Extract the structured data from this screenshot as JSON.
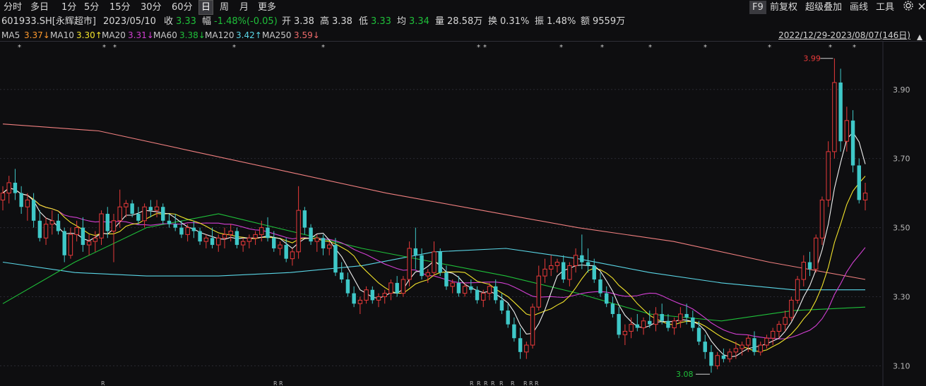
{
  "toolbar": {
    "periods": [
      "分时",
      "多日",
      "1分",
      "5分",
      "15分",
      "30分",
      "60分",
      "日",
      "周",
      "月",
      "更多"
    ],
    "active_period": "日",
    "right": {
      "f9": "F9",
      "fq": "前复权",
      "overlay": "超级叠加",
      "draw": "画线",
      "tools": "工具"
    },
    "settings_icon": "gear-icon",
    "close_icon": "close-icon"
  },
  "quote": {
    "code": "601933.SH[永辉超市]",
    "date": "2023/05/10",
    "close_label": "收",
    "close": "3.33",
    "change_label": "幅",
    "change": "-1.48%(-0.05)",
    "open_label": "开",
    "open": "3.38",
    "high_label": "高",
    "high": "3.38",
    "low_label": "低",
    "low": "3.33",
    "avg_label": "均",
    "avg": "3.34",
    "vol_label": "量",
    "vol": "28.58万",
    "turnover_label": "换",
    "turnover": "0.31%",
    "amp_label": "振",
    "amp": "1.48%",
    "amount_label": "额",
    "amount": "9559万"
  },
  "ma": [
    {
      "name": "MA5",
      "value": "3.37↓",
      "color": "#e6e6e6",
      "value_color": "#ff9a2e"
    },
    {
      "name": "MA10",
      "value": "3.30↑",
      "color": "#e6e6e6",
      "value_color": "#f2e32b"
    },
    {
      "name": "MA20",
      "value": "3.31↓",
      "color": "#e6e6e6",
      "value_color": "#d23fd2"
    },
    {
      "name": "MA60",
      "value": "3.38↓",
      "color": "#e6e6e6",
      "value_color": "#1fc03a"
    },
    {
      "name": "MA120",
      "value": "3.42↑",
      "color": "#e6e6e6",
      "value_color": "#5ad6e6"
    },
    {
      "name": "MA250",
      "value": "3.59↓",
      "color": "#e6e6e6",
      "value_color": "#ef6b6b"
    }
  ],
  "range_text": "2022/12/29-2023/08/07(146日)",
  "chart_data": {
    "type": "candlestick",
    "y_ticks": [
      "3.90",
      "3.70",
      "3.50",
      "3.30",
      "3.10"
    ],
    "ylim": [
      3.06,
      4.02
    ],
    "max_label": "3.99",
    "min_label": "3.08",
    "markers_top": "*",
    "markers_bottom": "R",
    "colors": {
      "up": "#e83a3a",
      "down": "#3fc8c8",
      "ma5": "#f2f2f2",
      "ma10": "#f2e32b",
      "ma20": "#d23fd2",
      "ma60": "#1fc03a",
      "ma120": "#5ad6e6",
      "ma250": "#ef7f7f",
      "grid": "#2a2a33"
    },
    "candles_ohlc": [
      [
        3.58,
        3.62,
        3.55,
        3.6
      ],
      [
        3.6,
        3.65,
        3.57,
        3.63
      ],
      [
        3.63,
        3.67,
        3.58,
        3.6
      ],
      [
        3.6,
        3.62,
        3.54,
        3.56
      ],
      [
        3.56,
        3.6,
        3.52,
        3.58
      ],
      [
        3.58,
        3.6,
        3.5,
        3.52
      ],
      [
        3.52,
        3.55,
        3.46,
        3.47
      ],
      [
        3.47,
        3.53,
        3.45,
        3.51
      ],
      [
        3.51,
        3.55,
        3.48,
        3.52
      ],
      [
        3.52,
        3.54,
        3.48,
        3.49
      ],
      [
        3.49,
        3.5,
        3.4,
        3.42
      ],
      [
        3.42,
        3.5,
        3.41,
        3.48
      ],
      [
        3.48,
        3.52,
        3.46,
        3.5
      ],
      [
        3.5,
        3.53,
        3.43,
        3.45
      ],
      [
        3.45,
        3.48,
        3.42,
        3.46
      ],
      [
        3.46,
        3.49,
        3.43,
        3.47
      ],
      [
        3.47,
        3.55,
        3.45,
        3.54
      ],
      [
        3.54,
        3.56,
        3.47,
        3.49
      ],
      [
        3.49,
        3.54,
        3.4,
        3.52
      ],
      [
        3.52,
        3.61,
        3.5,
        3.56
      ],
      [
        3.56,
        3.58,
        3.53,
        3.57
      ],
      [
        3.57,
        3.58,
        3.53,
        3.54
      ],
      [
        3.54,
        3.56,
        3.51,
        3.52
      ],
      [
        3.52,
        3.57,
        3.5,
        3.56
      ],
      [
        3.56,
        3.58,
        3.53,
        3.55
      ],
      [
        3.55,
        3.58,
        3.53,
        3.56
      ],
      [
        3.56,
        3.57,
        3.51,
        3.52
      ],
      [
        3.52,
        3.54,
        3.5,
        3.51
      ],
      [
        3.51,
        3.54,
        3.49,
        3.5
      ],
      [
        3.5,
        3.52,
        3.47,
        3.48
      ],
      [
        3.48,
        3.51,
        3.46,
        3.5
      ],
      [
        3.5,
        3.52,
        3.47,
        3.49
      ],
      [
        3.49,
        3.5,
        3.45,
        3.46
      ],
      [
        3.46,
        3.48,
        3.44,
        3.47
      ],
      [
        3.47,
        3.5,
        3.44,
        3.45
      ],
      [
        3.45,
        3.48,
        3.43,
        3.47
      ],
      [
        3.47,
        3.5,
        3.44,
        3.48
      ],
      [
        3.48,
        3.51,
        3.46,
        3.49
      ],
      [
        3.49,
        3.5,
        3.44,
        3.45
      ],
      [
        3.45,
        3.47,
        3.43,
        3.46
      ],
      [
        3.46,
        3.48,
        3.44,
        3.47
      ],
      [
        3.47,
        3.49,
        3.45,
        3.48
      ],
      [
        3.48,
        3.52,
        3.46,
        3.5
      ],
      [
        3.5,
        3.53,
        3.46,
        3.47
      ],
      [
        3.47,
        3.49,
        3.43,
        3.44
      ],
      [
        3.44,
        3.46,
        3.42,
        3.45
      ],
      [
        3.45,
        3.47,
        3.4,
        3.41
      ],
      [
        3.41,
        3.44,
        3.39,
        3.43
      ],
      [
        3.43,
        3.62,
        3.41,
        3.55
      ],
      [
        3.55,
        3.56,
        3.48,
        3.5
      ],
      [
        3.5,
        3.51,
        3.45,
        3.46
      ],
      [
        3.46,
        3.48,
        3.43,
        3.47
      ],
      [
        3.47,
        3.48,
        3.42,
        3.44
      ],
      [
        3.44,
        3.46,
        3.42,
        3.45
      ],
      [
        3.45,
        3.47,
        3.36,
        3.37
      ],
      [
        3.37,
        3.4,
        3.34,
        3.35
      ],
      [
        3.35,
        3.37,
        3.3,
        3.31
      ],
      [
        3.31,
        3.33,
        3.27,
        3.28
      ],
      [
        3.28,
        3.3,
        3.25,
        3.29
      ],
      [
        3.29,
        3.33,
        3.28,
        3.32
      ],
      [
        3.32,
        3.33,
        3.28,
        3.29
      ],
      [
        3.29,
        3.31,
        3.27,
        3.3
      ],
      [
        3.3,
        3.32,
        3.28,
        3.31
      ],
      [
        3.31,
        3.35,
        3.29,
        3.34
      ],
      [
        3.34,
        3.36,
        3.3,
        3.31
      ],
      [
        3.31,
        3.36,
        3.3,
        3.35
      ],
      [
        3.35,
        3.46,
        3.33,
        3.44
      ],
      [
        3.44,
        3.5,
        3.38,
        3.42
      ],
      [
        3.42,
        3.44,
        3.35,
        3.36
      ],
      [
        3.36,
        3.38,
        3.34,
        3.37
      ],
      [
        3.37,
        3.46,
        3.36,
        3.43
      ],
      [
        3.43,
        3.44,
        3.36,
        3.37
      ],
      [
        3.37,
        3.39,
        3.32,
        3.33
      ],
      [
        3.33,
        3.35,
        3.31,
        3.34
      ],
      [
        3.34,
        3.36,
        3.3,
        3.31
      ],
      [
        3.31,
        3.34,
        3.3,
        3.33
      ],
      [
        3.33,
        3.35,
        3.31,
        3.32
      ],
      [
        3.32,
        3.33,
        3.28,
        3.29
      ],
      [
        3.29,
        3.32,
        3.27,
        3.31
      ],
      [
        3.31,
        3.34,
        3.29,
        3.33
      ],
      [
        3.33,
        3.35,
        3.28,
        3.29
      ],
      [
        3.29,
        3.31,
        3.25,
        3.26
      ],
      [
        3.26,
        3.28,
        3.21,
        3.22
      ],
      [
        3.22,
        3.24,
        3.17,
        3.18
      ],
      [
        3.18,
        3.21,
        3.12,
        3.14
      ],
      [
        3.14,
        3.17,
        3.12,
        3.16
      ],
      [
        3.16,
        3.28,
        3.15,
        3.27
      ],
      [
        3.27,
        3.39,
        3.26,
        3.36
      ],
      [
        3.36,
        3.41,
        3.34,
        3.38
      ],
      [
        3.38,
        3.42,
        3.36,
        3.39
      ],
      [
        3.39,
        3.41,
        3.37,
        3.4
      ],
      [
        3.4,
        3.42,
        3.34,
        3.35
      ],
      [
        3.35,
        3.4,
        3.33,
        3.39
      ],
      [
        3.39,
        3.44,
        3.37,
        3.42
      ],
      [
        3.42,
        3.48,
        3.38,
        3.4
      ],
      [
        3.4,
        3.44,
        3.37,
        3.39
      ],
      [
        3.39,
        3.41,
        3.34,
        3.35
      ],
      [
        3.35,
        3.37,
        3.3,
        3.31
      ],
      [
        3.31,
        3.33,
        3.27,
        3.28
      ],
      [
        3.28,
        3.3,
        3.24,
        3.25
      ],
      [
        3.25,
        3.27,
        3.18,
        3.19
      ],
      [
        3.19,
        3.22,
        3.16,
        3.2
      ],
      [
        3.2,
        3.24,
        3.18,
        3.22
      ],
      [
        3.22,
        3.25,
        3.2,
        3.21
      ],
      [
        3.21,
        3.24,
        3.19,
        3.23
      ],
      [
        3.23,
        3.26,
        3.21,
        3.22
      ],
      [
        3.22,
        3.27,
        3.2,
        3.25
      ],
      [
        3.25,
        3.28,
        3.22,
        3.23
      ],
      [
        3.23,
        3.25,
        3.2,
        3.21
      ],
      [
        3.21,
        3.24,
        3.19,
        3.23
      ],
      [
        3.23,
        3.27,
        3.21,
        3.25
      ],
      [
        3.25,
        3.28,
        3.22,
        3.24
      ],
      [
        3.24,
        3.26,
        3.2,
        3.21
      ],
      [
        3.21,
        3.23,
        3.16,
        3.17
      ],
      [
        3.17,
        3.19,
        3.12,
        3.14
      ],
      [
        3.14,
        3.16,
        3.08,
        3.1
      ],
      [
        3.1,
        3.14,
        3.09,
        3.13
      ],
      [
        3.13,
        3.15,
        3.11,
        3.12
      ],
      [
        3.12,
        3.15,
        3.11,
        3.14
      ],
      [
        3.14,
        3.17,
        3.12,
        3.15
      ],
      [
        3.15,
        3.17,
        3.13,
        3.16
      ],
      [
        3.16,
        3.19,
        3.14,
        3.18
      ],
      [
        3.18,
        3.2,
        3.13,
        3.14
      ],
      [
        3.14,
        3.17,
        3.13,
        3.16
      ],
      [
        3.16,
        3.19,
        3.15,
        3.18
      ],
      [
        3.18,
        3.21,
        3.16,
        3.2
      ],
      [
        3.2,
        3.23,
        3.18,
        3.22
      ],
      [
        3.22,
        3.26,
        3.2,
        3.24
      ],
      [
        3.24,
        3.3,
        3.23,
        3.29
      ],
      [
        3.29,
        3.36,
        3.28,
        3.35
      ],
      [
        3.35,
        3.42,
        3.33,
        3.4
      ],
      [
        3.4,
        3.43,
        3.36,
        3.38
      ],
      [
        3.38,
        3.48,
        3.37,
        3.47
      ],
      [
        3.47,
        3.59,
        3.45,
        3.58
      ],
      [
        3.58,
        3.75,
        3.56,
        3.72
      ],
      [
        3.72,
        3.99,
        3.7,
        3.92
      ],
      [
        3.92,
        3.96,
        3.72,
        3.75
      ],
      [
        3.75,
        3.85,
        3.72,
        3.81
      ],
      [
        3.81,
        3.84,
        3.66,
        3.68
      ],
      [
        3.68,
        3.7,
        3.57,
        3.58
      ],
      [
        3.58,
        3.63,
        3.55,
        3.6
      ]
    ],
    "ma250": [
      3.8,
      3.78,
      3.72,
      3.66,
      3.6,
      3.55,
      3.5,
      3.46,
      3.4,
      3.35
    ],
    "ma120": [
      3.4,
      3.37,
      3.36,
      3.36,
      3.37,
      3.39,
      3.43,
      3.44,
      3.41,
      3.37,
      3.34,
      3.32,
      3.32
    ],
    "ma60": [
      3.28,
      3.4,
      3.5,
      3.54,
      3.49,
      3.44,
      3.4,
      3.36,
      3.31,
      3.25,
      3.23,
      3.26,
      3.27
    ]
  }
}
